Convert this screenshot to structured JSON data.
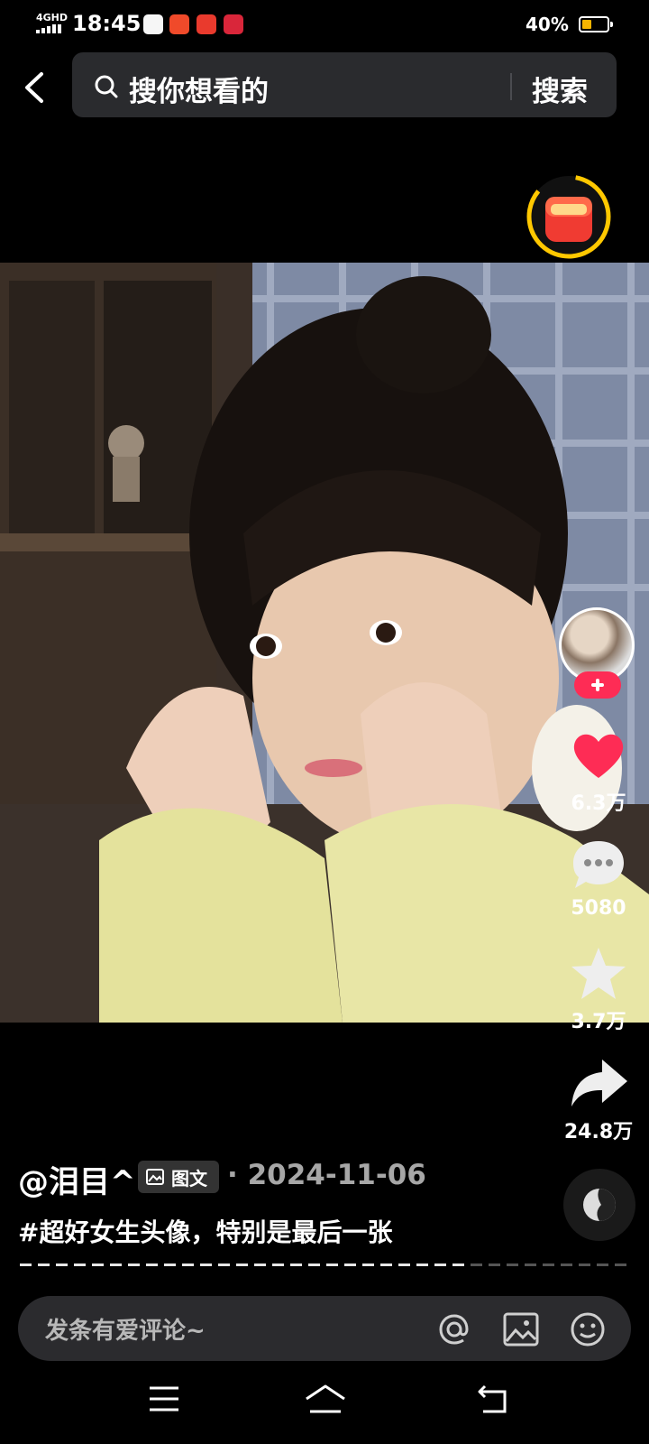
{
  "status_bar": {
    "network": "4GHD",
    "time": "18:45",
    "battery_percent": "40%",
    "battery_level": 0.4,
    "app_icons": [
      "100-app-icon",
      "red-app-icon-1",
      "red-app-icon-2",
      "red-app-icon-3"
    ]
  },
  "search": {
    "placeholder": "搜你想看的",
    "button": "搜索"
  },
  "post": {
    "author": "@泪目^",
    "type_tag": "图文",
    "date_sep": "·",
    "date": "2024-11-06",
    "caption": "#超好女生头像，特别是最后一张",
    "image_progress": 0.72
  },
  "actions": {
    "likes": "6.3万",
    "comments": "5080",
    "favorites": "3.7万",
    "shares": "24.8万"
  },
  "comment_bar": {
    "placeholder": "发条有爱评论~"
  },
  "colors": {
    "accent_red": "#fe2c55",
    "battery_yellow": "#f5b400",
    "redpacket_ring": "#ffc800"
  }
}
